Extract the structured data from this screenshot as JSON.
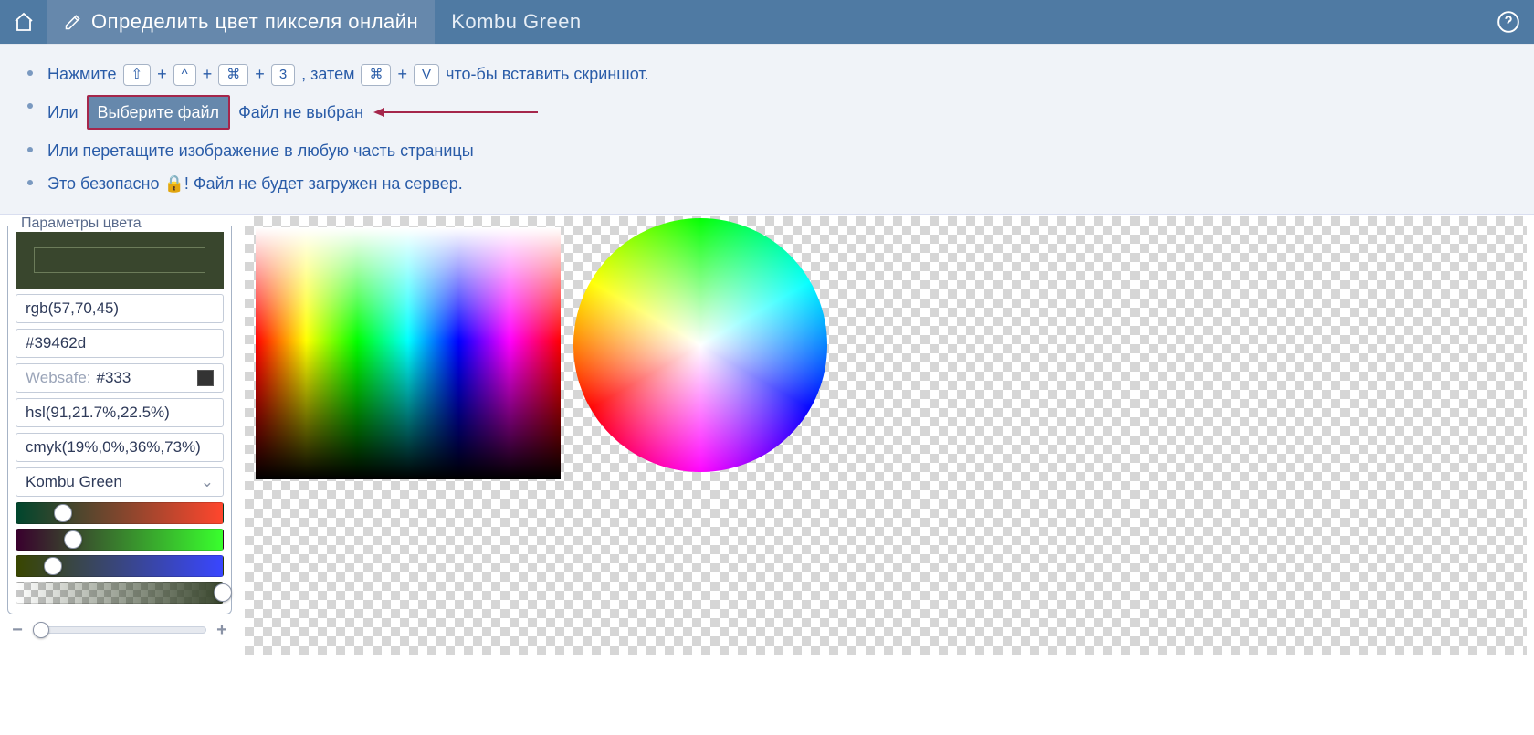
{
  "header": {
    "tool_title": "Определить цвет пикселя онлайн",
    "color_name": "Kombu Green"
  },
  "info": {
    "line1_prefix": "Нажмите ",
    "k1": "⇧",
    "plus": "+",
    "k2": "^",
    "k3": "⌘",
    "k4": "3",
    "then": ", затем ",
    "k5": "⌘",
    "k6": "V",
    "line1_suffix": " что-бы вставить скриншот.",
    "line2_prefix": "Или ",
    "file_button": "Выберите файл",
    "file_not_chosen": "Файл не выбран",
    "line3": "Или перетащите изображение в любую часть страницы",
    "line4_a": "Это безопасно ",
    "lock_icon": "🔒",
    "line4_b": "! Файл не будет загружен на сервер."
  },
  "panel": {
    "legend": "Параметры цвета",
    "swatch_hex": "#39462d",
    "rgb": "rgb(57,70,45)",
    "hex": "#39462d",
    "websafe_label": "Websafe:",
    "websafe_value": "#333",
    "hsl": "hsl(91,21.7%,22.5%)",
    "cmyk": "cmyk(19%,0%,36%,73%)",
    "name": "Kombu Green",
    "r_percent": 22.4,
    "g_percent": 27.5,
    "b_percent": 17.6,
    "a_percent": 100
  },
  "zoom": {
    "minus": "−",
    "plus": "+"
  }
}
